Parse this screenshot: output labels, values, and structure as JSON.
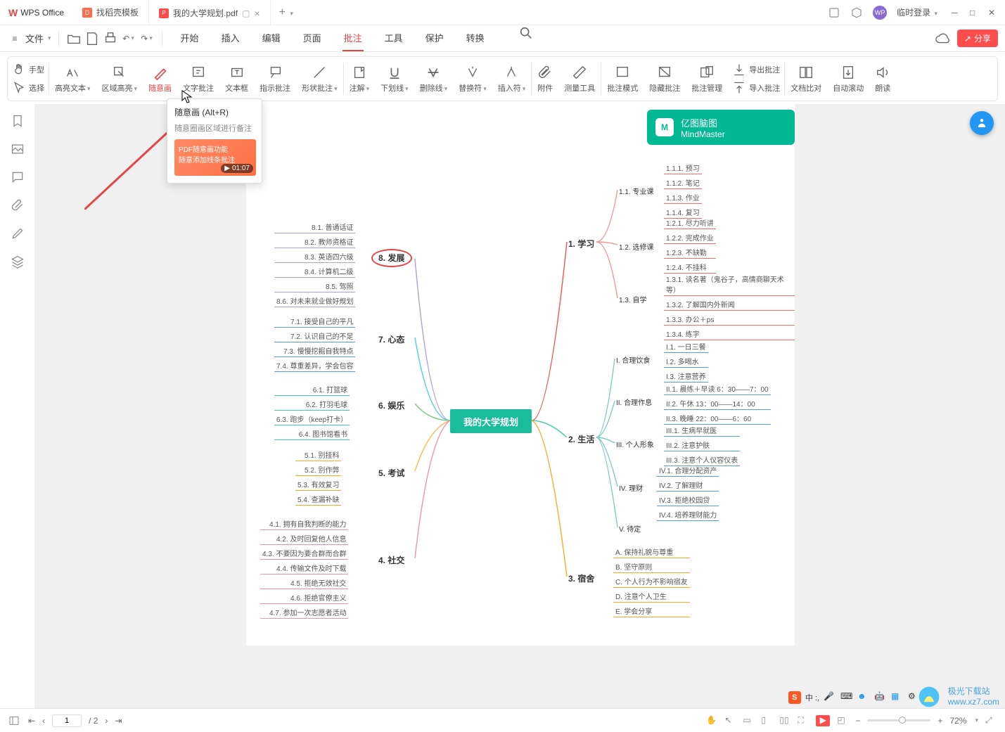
{
  "app": {
    "name": "WPS Office"
  },
  "tabs": [
    {
      "label": "找稻壳模板"
    },
    {
      "label": "我的大学规划.pdf"
    }
  ],
  "title_right": {
    "login": "临时登录"
  },
  "menu_icons": {
    "file": "文件"
  },
  "main_tabs": [
    "开始",
    "插入",
    "编辑",
    "页面",
    "批注",
    "工具",
    "保护",
    "转换"
  ],
  "active_tab": "批注",
  "ribbon": {
    "hand": "手型",
    "select": "选择",
    "highlight_text": "高亮文本",
    "area_highlight": "区域高亮",
    "freehand": "随意画",
    "text_annot": "文字批注",
    "textbox": "文本框",
    "callout": "指示批注",
    "shape_annot": "形状批注",
    "annot": "注解",
    "underline": "下划线",
    "strike": "删除线",
    "replace": "替换符",
    "insert": "插入符",
    "attach": "附件",
    "measure": "测量工具",
    "annot_mode": "批注模式",
    "hide_annot": "隐藏批注",
    "manage_annot": "批注管理",
    "export_annot": "导出批注",
    "import_annot": "导入批注",
    "compare": "文档比对",
    "autoscroll": "自动滚动",
    "read": "朗读"
  },
  "tooltip": {
    "title": "随意画 (Alt+R)",
    "desc": "随意圈画区域进行备注",
    "thumb_l1": "PDF随意画功能",
    "thumb_l2": "随意添加线条批注",
    "duration": "01:07"
  },
  "share": "分享",
  "mindmap": {
    "brand_cn": "亿图脑图",
    "brand_en": "MindMaster",
    "center": "我的大学规划",
    "n8": {
      "t": "8. 发展",
      "items": [
        "8.1. 普通话证",
        "8.2. 教师资格证",
        "8.3. 英语四六级",
        "8.4. 计算机二级",
        "8.5. 驾照",
        "8.6. 对未来就业做好规划"
      ]
    },
    "n7": {
      "t": "7. 心态",
      "items": [
        "7.1. 接受自己的平凡",
        "7.2. 认识自己的不足",
        "7.3. 慢慢挖掘自我特点",
        "7.4. 尊重差异，学会包容"
      ]
    },
    "n6": {
      "t": "6. 娱乐",
      "items": [
        "6.1. 打篮球",
        "6.2. 打羽毛球",
        "6.3. 跑步（keep打卡）",
        "6.4. 图书馆看书"
      ]
    },
    "n5": {
      "t": "5. 考试",
      "items": [
        "5.1. 别挂科",
        "5.2. 别作弊",
        "5.3. 有效复习",
        "5.4. 查漏补缺"
      ]
    },
    "n4": {
      "t": "4. 社交",
      "items": [
        "4.1. 拥有自我判断的能力",
        "4.2. 及时回复他人信息",
        "4.3. 不要因为要合群而合群",
        "4.4. 传输文件及时下载",
        "4.5. 拒绝无效社交",
        "4.6. 拒绝官僚主义",
        "4.7. 参加一次志愿者活动"
      ]
    },
    "n1": {
      "t": "1. 学习",
      "sub": [
        {
          "t": "1.1. 专业课",
          "items": [
            "1.1.1. 预习",
            "1.1.2. 笔记",
            "1.1.3. 作业",
            "1.1.4. 复习"
          ]
        },
        {
          "t": "1.2. 选修课",
          "items": [
            "1.2.1. 尽力听讲",
            "1.2.2. 完成作业",
            "1.2.3. 不缺勤",
            "1.2.4. 不挂科"
          ]
        },
        {
          "t": "1.3. 自学",
          "items": [
            "1.3.1. 读名著（鬼谷子，高情商聊天术等）",
            "1.3.2. 了解国内外新闻",
            "1.3.3. 办公＋ps",
            "1.3.4. 练字"
          ]
        }
      ]
    },
    "n2": {
      "t": "2. 生活",
      "sub": [
        {
          "t": "I. 合理饮食",
          "items": [
            "I.1. 一日三餐",
            "I.2. 多喝水",
            "I.3. 注意营养"
          ]
        },
        {
          "t": "II. 合理作息",
          "items": [
            "II.1. 晨练＋早读 6：30——7：00",
            "II.2. 午休 13：00——14：00",
            "II.3. 晚睡 22：00——6：60"
          ]
        },
        {
          "t": "III. 个人形象",
          "items": [
            "III.1. 生病早就医",
            "III.2. 注意护肤",
            "III.3. 注意个人仪容仪表"
          ]
        },
        {
          "t": "IV. 理财",
          "items": [
            "IV.1. 合理分配资产",
            "IV.2. 了解理财",
            "IV.3. 拒绝校园贷",
            "IV.4. 培养理财能力"
          ]
        },
        {
          "t": "V. 待定",
          "items": []
        }
      ]
    },
    "n3": {
      "t": "3. 宿舍",
      "items": [
        "A. 保持礼貌与尊重",
        "B. 坚守原则",
        "C. 个人行为不影响宿友",
        "D. 注意个人卫生",
        "E. 学会分享"
      ]
    }
  },
  "status": {
    "page": "1",
    "total": "/ 2",
    "zoom": "72%"
  },
  "watermark": "www.xz7.com"
}
